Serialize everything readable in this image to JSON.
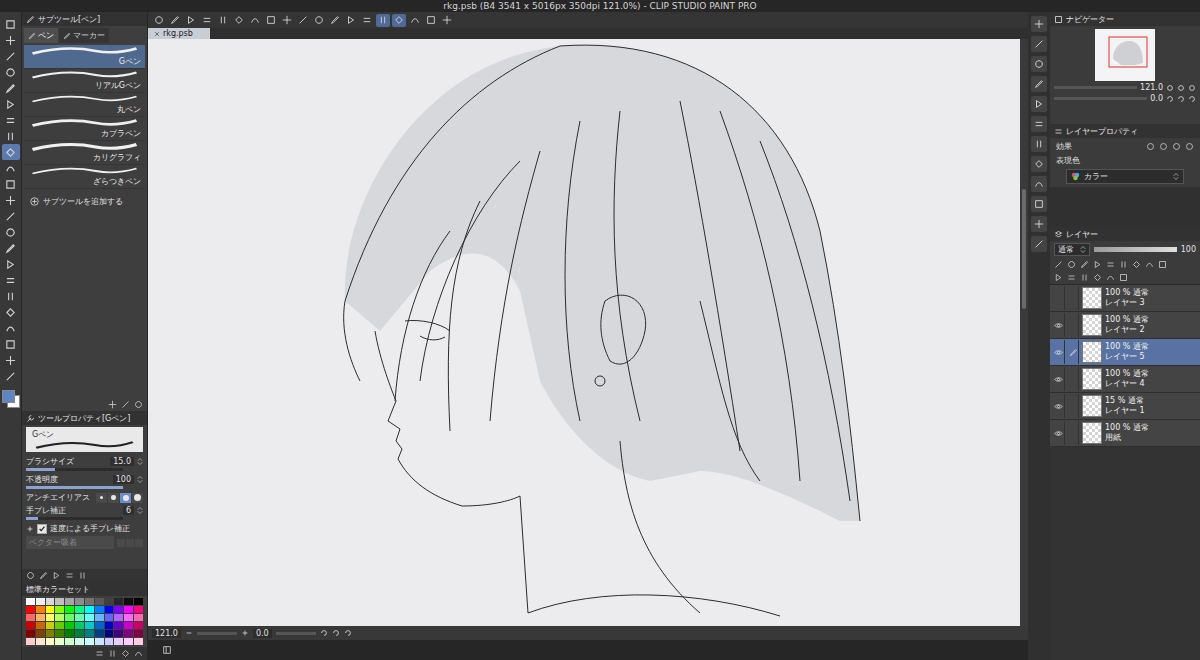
{
  "window": {
    "title": "rkg.psb (B4 3541 x 5016px 350dpi 121.0%) - CLIP STUDIO PAINT PRO"
  },
  "tools": [
    {
      "selected": false
    },
    {
      "selected": false
    },
    {
      "selected": false
    },
    {
      "selected": false
    },
    {
      "selected": false
    },
    {
      "selected": false
    },
    {
      "selected": false
    },
    {
      "selected": false
    },
    {
      "selected": true
    },
    {
      "selected": false
    },
    {
      "selected": false
    },
    {
      "selected": false
    },
    {
      "selected": false
    },
    {
      "selected": false
    },
    {
      "selected": false
    },
    {
      "selected": false
    },
    {
      "selected": false
    },
    {
      "selected": false
    },
    {
      "selected": false
    },
    {
      "selected": false
    },
    {
      "selected": false
    },
    {
      "selected": false
    },
    {
      "selected": false
    }
  ],
  "command_bar": {
    "buttons": [
      {
        "selected": false
      },
      {
        "selected": false
      },
      {
        "selected": false
      },
      {
        "selected": false
      },
      {
        "selected": false
      },
      {
        "selected": false
      },
      {
        "selected": false
      },
      {
        "selected": false
      },
      {
        "selected": false
      },
      {
        "selected": false
      },
      {
        "selected": false
      },
      {
        "selected": false
      },
      {
        "selected": false
      },
      {
        "selected": false
      },
      {
        "selected": true
      },
      {
        "selected": true
      },
      {
        "selected": false
      },
      {
        "selected": false
      },
      {
        "selected": false
      }
    ]
  },
  "sub_tool": {
    "title": "サブツール[ペン]",
    "tabs": [
      {
        "label": "ペン",
        "selected": true
      },
      {
        "label": "マーカー",
        "selected": false
      }
    ],
    "items": [
      {
        "label": "Gペン",
        "selected": true
      },
      {
        "label": "リアルGペン",
        "selected": false
      },
      {
        "label": "丸ペン",
        "selected": false
      },
      {
        "label": "カブラペン",
        "selected": false
      },
      {
        "label": "カリグラフィ",
        "selected": false
      },
      {
        "label": "ざらつきペン",
        "selected": false
      }
    ],
    "add_label": "サブツールを追加する"
  },
  "tool_property": {
    "title": "ツールプロパティ[Gペン]",
    "preview_label": "Gペン",
    "rows": [
      {
        "kind": "slider",
        "label": "ブラシサイズ",
        "value": "15.0",
        "level": 0.3,
        "disabled": false
      },
      {
        "kind": "slider",
        "label": "不透明度",
        "value": "100",
        "level": 1,
        "disabled": false
      },
      {
        "kind": "options",
        "label": "アンチエイリアス",
        "options": [
          {
            "selected": false
          },
          {
            "selected": false
          },
          {
            "selected": true
          },
          {
            "selected": false
          }
        ],
        "disabled": false
      },
      {
        "kind": "slider",
        "label": "手ブレ補正",
        "value": "6",
        "level": 0.12,
        "disabled": false
      },
      {
        "kind": "checkbox",
        "label": "速度による手ブレ補正",
        "checked": true,
        "disabled": false
      },
      {
        "kind": "button",
        "label": "ベクター吸着",
        "disabled": true
      }
    ]
  },
  "color_set": {
    "title": "標準カラーセット",
    "swatches": [
      {
        "color": "#ffffff"
      },
      {
        "color": "#f0f0f0"
      },
      {
        "color": "#d9d9d9"
      },
      {
        "color": "#bfbfbf"
      },
      {
        "color": "#a6a6a6"
      },
      {
        "color": "#8c8c8c"
      },
      {
        "color": "#737373"
      },
      {
        "color": "#595959"
      },
      {
        "color": "#404040"
      },
      {
        "color": "#262626"
      },
      {
        "color": "#0d0d0d"
      },
      {
        "color": "#000000"
      },
      {
        "color": "#ff0000"
      },
      {
        "color": "#ff8000"
      },
      {
        "color": "#ffff00"
      },
      {
        "color": "#80ff00"
      },
      {
        "color": "#00ff00"
      },
      {
        "color": "#00ff80"
      },
      {
        "color": "#00ffff"
      },
      {
        "color": "#0080ff"
      },
      {
        "color": "#0000ff"
      },
      {
        "color": "#8000ff"
      },
      {
        "color": "#ff00ff"
      },
      {
        "color": "#ff0080"
      },
      {
        "color": "#ff6666"
      },
      {
        "color": "#ffb366"
      },
      {
        "color": "#ffff66"
      },
      {
        "color": "#b3ff66"
      },
      {
        "color": "#66ff66"
      },
      {
        "color": "#66ffb3"
      },
      {
        "color": "#66ffff"
      },
      {
        "color": "#66b3ff"
      },
      {
        "color": "#6666ff"
      },
      {
        "color": "#b366ff"
      },
      {
        "color": "#ff66ff"
      },
      {
        "color": "#ff66b3"
      },
      {
        "color": "#cc0000"
      },
      {
        "color": "#cc6600"
      },
      {
        "color": "#cccc00"
      },
      {
        "color": "#66cc00"
      },
      {
        "color": "#00cc00"
      },
      {
        "color": "#00cc66"
      },
      {
        "color": "#00cccc"
      },
      {
        "color": "#0066cc"
      },
      {
        "color": "#0000cc"
      },
      {
        "color": "#6600cc"
      },
      {
        "color": "#cc00cc"
      },
      {
        "color": "#cc0066"
      },
      {
        "color": "#800000"
      },
      {
        "color": "#804000"
      },
      {
        "color": "#808000"
      },
      {
        "color": "#408000"
      },
      {
        "color": "#008000"
      },
      {
        "color": "#008040"
      },
      {
        "color": "#008080"
      },
      {
        "color": "#004080"
      },
      {
        "color": "#000080"
      },
      {
        "color": "#400080"
      },
      {
        "color": "#800080"
      },
      {
        "color": "#800040"
      },
      {
        "color": "#ffcccc"
      },
      {
        "color": "#ffe6cc"
      },
      {
        "color": "#ffffcc"
      },
      {
        "color": "#e6ffcc"
      },
      {
        "color": "#ccffcc"
      },
      {
        "color": "#ccffe6"
      },
      {
        "color": "#ccffff"
      },
      {
        "color": "#cce6ff"
      },
      {
        "color": "#ccccff"
      },
      {
        "color": "#e6ccff"
      },
      {
        "color": "#ffccff"
      },
      {
        "color": "#ffcce6"
      }
    ]
  },
  "canvas": {
    "tab": "rkg.psb"
  },
  "status_bar": {
    "zoom": "121.0",
    "angle": "0.0"
  },
  "navigator": {
    "title": "ナビゲーター",
    "zoom": "121.0",
    "angle": "0.0"
  },
  "layer_property": {
    "title": "レイヤープロパティ",
    "effect_label": "効果",
    "color_label": "表現色",
    "color_value": "カラー"
  },
  "layers": {
    "title": "レイヤー",
    "blend": "通常",
    "opacity": "100",
    "items": [
      {
        "info": "100 % 通常",
        "name": "レイヤー 3",
        "visible": false,
        "selected": false
      },
      {
        "info": "100 % 通常",
        "name": "レイヤー 2",
        "visible": true,
        "selected": false
      },
      {
        "info": "100 % 通常",
        "name": "レイヤー 5",
        "visible": true,
        "selected": true
      },
      {
        "info": "100 % 通常",
        "name": "レイヤー 4",
        "visible": true,
        "selected": false
      },
      {
        "info": "15 % 通常",
        "name": "レイヤー 1",
        "visible": true,
        "selected": false
      },
      {
        "info": "100 % 通常",
        "name": "用紙",
        "visible": true,
        "selected": false
      }
    ]
  }
}
